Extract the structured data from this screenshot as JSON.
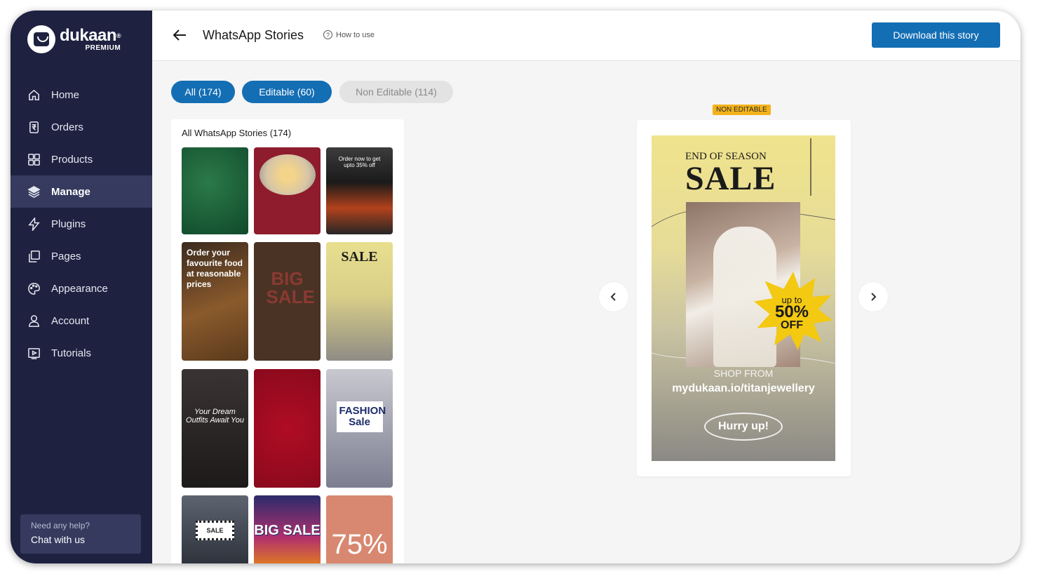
{
  "brand": {
    "name": "dukaan",
    "reg": "®",
    "tier": "PREMIUM"
  },
  "sidebar": {
    "items": [
      {
        "label": "Home",
        "icon": "home-icon"
      },
      {
        "label": "Orders",
        "icon": "orders-icon"
      },
      {
        "label": "Products",
        "icon": "products-icon"
      },
      {
        "label": "Manage",
        "icon": "layers-icon",
        "active": true
      },
      {
        "label": "Plugins",
        "icon": "bolt-icon"
      },
      {
        "label": "Pages",
        "icon": "pages-icon"
      },
      {
        "label": "Appearance",
        "icon": "palette-icon"
      },
      {
        "label": "Account",
        "icon": "user-icon"
      },
      {
        "label": "Tutorials",
        "icon": "play-icon"
      }
    ],
    "help": {
      "question": "Need any help?",
      "action": "Chat with us"
    }
  },
  "header": {
    "title": "WhatsApp Stories",
    "how_to": "How to use",
    "download": "Download this story"
  },
  "filters": [
    {
      "label": "All (174)",
      "selected": true
    },
    {
      "label": "Editable (60)",
      "selected": true
    },
    {
      "label": "Non Editable (114)",
      "selected": false
    }
  ],
  "panel": {
    "title": "All WhatsApp Stories (174)",
    "thumbs": [
      {
        "style": "green",
        "text": ""
      },
      {
        "style": "red",
        "text": ""
      },
      {
        "style": "fire",
        "text": "Order now to get upto 35% off"
      },
      {
        "style": "food",
        "text": "Order your favourite food at reasonable prices"
      },
      {
        "style": "brown",
        "text": "BIG SALE"
      },
      {
        "style": "sale",
        "text": "SALE"
      },
      {
        "style": "closet",
        "text": "Your Dream Outfits Await You"
      },
      {
        "style": "hearts",
        "text": ""
      },
      {
        "style": "fashion",
        "text": "FASHION Sale"
      },
      {
        "style": "dark",
        "text": "SALE"
      },
      {
        "style": "bigsale",
        "text": "BIG SALE"
      },
      {
        "style": "coral",
        "text": "75%"
      }
    ]
  },
  "preview": {
    "badge": "NON EDITABLE",
    "story": {
      "line1": "END OF SEASON",
      "line2": "SALE",
      "upto": "up to",
      "discount": "50%",
      "off": "OFF",
      "shop_from": "SHOP FROM",
      "url": "mydukaan.io/titanjewellery",
      "cta": "Hurry up!"
    }
  },
  "colors": {
    "sidebar": "#1e2140",
    "active": "#353a5e",
    "primary": "#146eb4",
    "badge": "#f3b21b"
  }
}
